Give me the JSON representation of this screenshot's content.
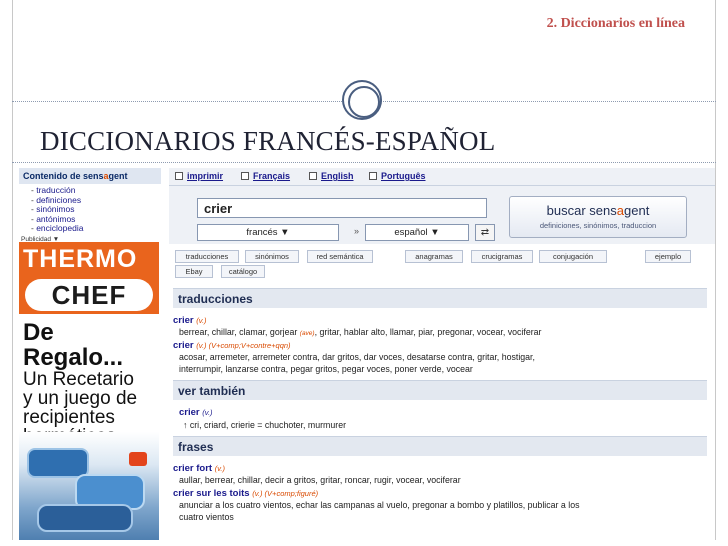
{
  "slide": {
    "section_title": "2. Diccionarios en línea",
    "heading": "DICCIONARIOS FRANCÉS-ESPAÑOL"
  },
  "sidebar": {
    "header_pre": "Contenido de sens",
    "header_a": "a",
    "header_post": "gent",
    "items": [
      "traducción",
      "definiciones",
      "sinónimos",
      "antónimos",
      "enciclopedia"
    ],
    "publicidad": "Publicidad ▼"
  },
  "ad": {
    "brand_top": "THERMO",
    "brand_bottom": "CHEF",
    "line1": "De",
    "line2": "Regalo...",
    "line3": "Un Recetario",
    "line4": "y un juego de",
    "line5": "recipientes",
    "line6": "herméticos"
  },
  "lang_bar": {
    "links": [
      "imprimir",
      "Français",
      "English",
      "Português"
    ]
  },
  "search": {
    "query": "crier",
    "source_lang": "francés   ▼",
    "target_lang": "español   ▼",
    "arrow": "»",
    "swap": "⇄",
    "button_pre": "buscar sens",
    "button_a": "a",
    "button_post": "gent",
    "button_sub": "definiciones, sinónimos, traduccion"
  },
  "tabs": [
    "traducciones",
    "sinónimos",
    "red semántica",
    "anagramas",
    "crucigramas",
    "conjugación",
    "ejemplo",
    "Ebay",
    "catálogo"
  ],
  "traducciones": {
    "title": "traducciones",
    "entry1_word": "crier",
    "entry1_pos": "(v.)",
    "entry1_defs_a": "berrear, chillar, clamar, gorjear",
    "entry1_ins": "(ave)",
    "entry1_defs_b": ", gritar, hablar alto, llamar, piar, pregonar, vocear, vociferar",
    "entry2_word": "crier",
    "entry2_pos": "(v.) (V+comp;V+contre+qqn)",
    "entry2_line1": "acosar, arremeter, arremeter contra, dar gritos, dar voces, desatarse contra, gritar, hostigar,",
    "entry2_line2": "interrumpir, lanzarse contra, pegar gritos, pegar voces, poner verde, vocear"
  },
  "ver_tambien": {
    "title": "ver también",
    "word": "crier",
    "pos": "(v.)",
    "defs": "↑ cri, criard, crierie = chuchoter, murmurer"
  },
  "frases": {
    "title": "frases",
    "entry1_word": "crier fort",
    "entry1_pos": "(v.)",
    "entry1_defs": "aullar, berrear, chillar, decir a gritos, gritar, roncar, rugir, vocear, vociferar",
    "entry2_word": "crier sur les toits",
    "entry2_pos": "(v.) (V+comp;figuré)",
    "entry2_line1": "anunciar a los cuatro vientos, echar las campanas al vuelo, pregonar a bombo y platillos, publicar a los",
    "entry2_line2": "cuatro vientos"
  }
}
